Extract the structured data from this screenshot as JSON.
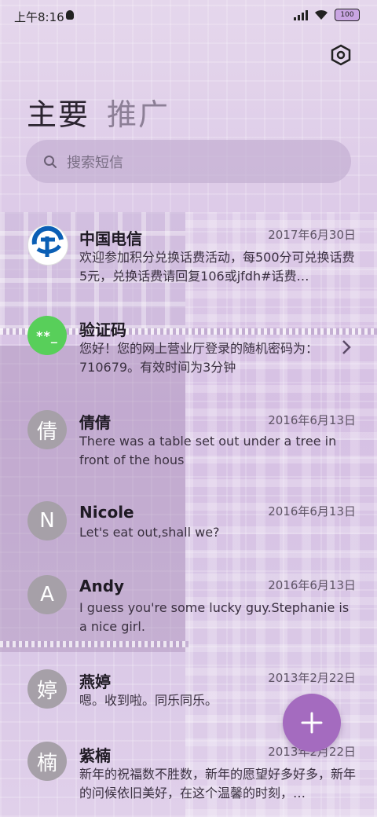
{
  "status": {
    "time": "上午8:16",
    "battery": "100"
  },
  "tabs": [
    {
      "label": "主要",
      "active": true
    },
    {
      "label": "推广",
      "active": false
    }
  ],
  "search": {
    "placeholder": "搜索短信"
  },
  "messages": [
    {
      "name": "中国电信",
      "date": "2017年6月30日",
      "preview": "欢迎参加积分兑换话费活动，每500分可兑换话费5元，兑换话费请回复106或jfdh#话费…",
      "avatar": "telecom-logo"
    },
    {
      "name": "验证码",
      "date": "",
      "preview": "您好！您的网上营业厅登录的随机密码为：710679。有效时间为3分钟",
      "avatar_text": "**_"
    },
    {
      "name": "倩倩",
      "date": "2016年6月13日",
      "preview": "There was a table set out under a tree in front of the hous",
      "avatar_text": "倩"
    },
    {
      "name": "Nicole",
      "date": "2016年6月13日",
      "preview": "Let's eat out,shall we?",
      "avatar_text": "N"
    },
    {
      "name": "Andy",
      "date": "2016年6月13日",
      "preview": "I guess you're some lucky guy.Stephanie is a nice girl.",
      "avatar_text": "A"
    },
    {
      "name": "燕婷",
      "date": "2013年2月22日",
      "preview": "嗯。收到啦。同乐同乐。",
      "avatar_text": "婷"
    },
    {
      "name": "紫楠",
      "date": "2013年2月22日",
      "preview": "新年的祝福数不胜数，新年的愿望好多好多，新年的问候依旧美好，在这个温馨的时刻，…",
      "avatar_text": "楠"
    }
  ],
  "colors": {
    "accent": "#a46bbf",
    "verification": "#58cf5a"
  }
}
